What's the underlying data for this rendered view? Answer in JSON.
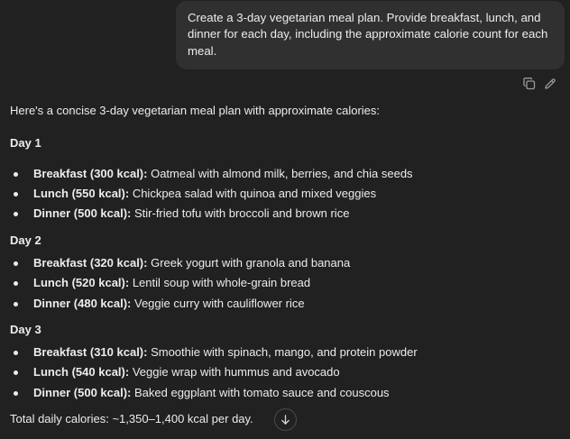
{
  "user_message": "Create a 3-day vegetarian meal plan. Provide breakfast, lunch, and dinner for each day, including the approximate calorie count for each meal.",
  "message_actions": [
    {
      "name": "copy-icon"
    },
    {
      "name": "edit-icon"
    }
  ],
  "assistant": {
    "intro": "Here's a concise 3-day vegetarian meal plan with approximate calories:",
    "days": [
      {
        "title": "Day 1",
        "meals": [
          {
            "label": "Breakfast (300 kcal):",
            "text": " Oatmeal with almond milk, berries, and chia seeds"
          },
          {
            "label": "Lunch (550 kcal):",
            "text": " Chickpea salad with quinoa and mixed veggies"
          },
          {
            "label": "Dinner (500 kcal):",
            "text": " Stir-fried tofu with broccoli and brown rice"
          }
        ]
      },
      {
        "title": "Day 2",
        "meals": [
          {
            "label": "Breakfast (320 kcal):",
            "text": " Greek yogurt with granola and banana"
          },
          {
            "label": "Lunch (520 kcal):",
            "text": " Lentil soup with whole-grain bread"
          },
          {
            "label": "Dinner (480 kcal):",
            "text": " Veggie curry with cauliflower rice"
          }
        ]
      },
      {
        "title": "Day 3",
        "meals": [
          {
            "label": "Breakfast (310 kcal):",
            "text": " Smoothie with spinach, mango, and protein powder"
          },
          {
            "label": "Lunch (540 kcal):",
            "text": " Veggie wrap with hummus and avocado"
          },
          {
            "label": "Dinner (500 kcal):",
            "text": " Baked eggplant with tomato sauce and couscous"
          }
        ]
      }
    ],
    "total": "Total daily calories: ~1,350–1,400 kcal per day."
  },
  "scroll_button": {
    "icon": "arrow-down-icon"
  }
}
